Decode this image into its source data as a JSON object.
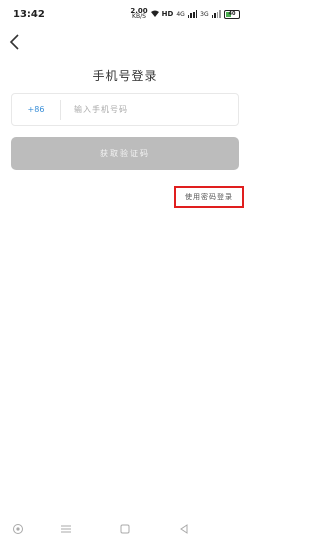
{
  "status_bar": {
    "time": "13:42",
    "net_speed_value": "2.00",
    "net_speed_unit": "KB/S",
    "hd_label": "HD",
    "signal_1_label": "4G",
    "signal_2_label": "3G",
    "battery_percent": "40"
  },
  "header": {
    "back_icon": "chevron-left-icon",
    "title": "手机号登录"
  },
  "phone_input": {
    "country_code": "+86",
    "placeholder": "输入手机号码",
    "value": ""
  },
  "get_code_button": {
    "label": "获取验证码",
    "enabled": false
  },
  "password_login_link": {
    "label": "使用密码登录",
    "highlight_color": "#e01e1e"
  },
  "nav_bar": {
    "items": [
      "assistant-circle-icon",
      "menu-icon",
      "home-square-icon",
      "back-triangle-icon"
    ]
  },
  "colors": {
    "accent": "#3a8fd8",
    "disabled_button": "#bcbcbc",
    "highlight_border": "#e01e1e"
  }
}
